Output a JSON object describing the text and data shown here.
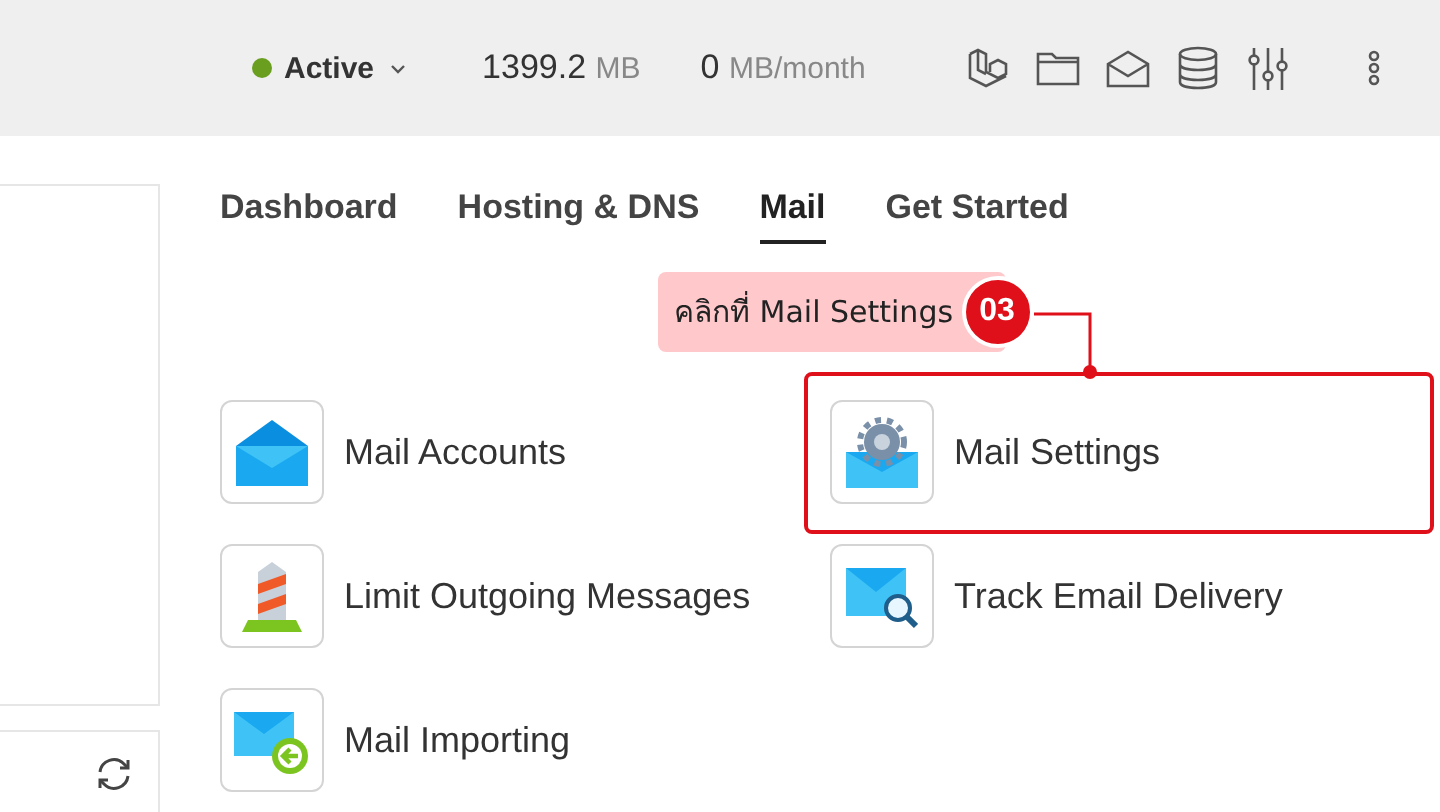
{
  "status_bar": {
    "status": "Active",
    "disk_value": "1399.2",
    "disk_unit": "MB",
    "traffic_value": "0",
    "traffic_unit": "MB/month"
  },
  "tabs": [
    {
      "label": "Dashboard",
      "selected": false
    },
    {
      "label": "Hosting & DNS",
      "selected": false
    },
    {
      "label": "Mail",
      "selected": true
    },
    {
      "label": "Get Started",
      "selected": false
    }
  ],
  "callout": {
    "text": "คลิกที่ Mail Settings",
    "step": "03"
  },
  "tiles": [
    {
      "label": "Mail Accounts",
      "kind": "mail",
      "highlighted": false
    },
    {
      "label": "Mail Settings",
      "kind": "settings",
      "highlighted": true
    },
    {
      "label": "Limit Outgoing Messages",
      "kind": "limit",
      "highlighted": false
    },
    {
      "label": "Track Email Delivery",
      "kind": "track",
      "highlighted": false
    },
    {
      "label": "Mail Importing",
      "kind": "import",
      "highlighted": false
    }
  ]
}
